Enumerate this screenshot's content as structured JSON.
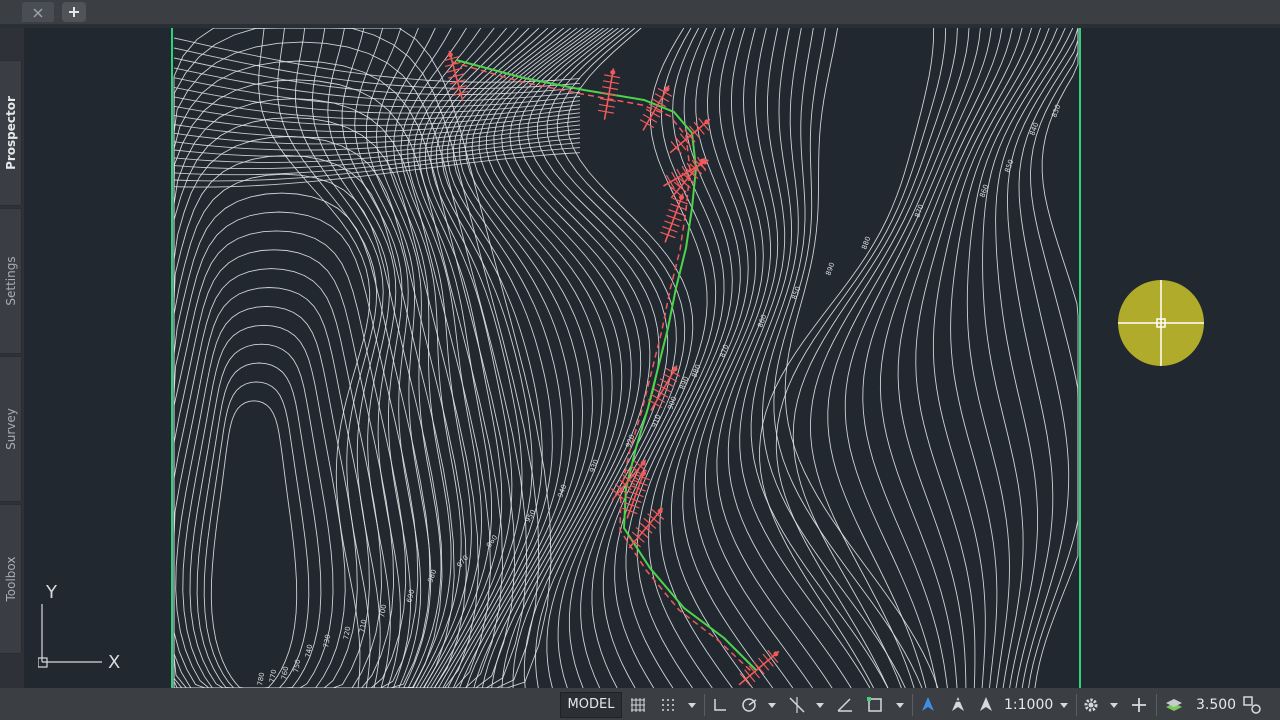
{
  "palette": {
    "tabs": [
      {
        "label": "Prospector",
        "active": true
      },
      {
        "label": "Settings",
        "active": false
      },
      {
        "label": "Survey",
        "active": false
      },
      {
        "label": "Toolbox",
        "active": false
      }
    ]
  },
  "drawing": {
    "contour_labels": [
      "830",
      "840",
      "850",
      "860",
      "870",
      "880",
      "890",
      "850",
      "860",
      "870",
      "880",
      "890",
      "900",
      "910",
      "920",
      "930",
      "940",
      "950",
      "960",
      "970",
      "980",
      "690",
      "700",
      "710",
      "720",
      "730",
      "740",
      "750",
      "760",
      "770",
      "780"
    ],
    "ucs": {
      "x_label": "X",
      "y_label": "Y"
    },
    "colors": {
      "background": "#212830",
      "contours": "#e3e5e8",
      "alignment": "#4cd44c",
      "sections": "#f05a5a",
      "boundary": "#2fd17a"
    }
  },
  "statusbar": {
    "model_label": "MODEL",
    "scale": "1:1000",
    "annotation_scale": "3.500",
    "icons": [
      "grid-icon",
      "snap-icon",
      "ortho-icon",
      "polar-icon",
      "osnap-icon",
      "isodraft-icon",
      "selection-cycling-icon",
      "annotation-visibility-icon",
      "auto-scale-icon",
      "workspace-icon",
      "gear-icon",
      "plus-icon",
      "layers-icon",
      "properties-icon"
    ]
  }
}
